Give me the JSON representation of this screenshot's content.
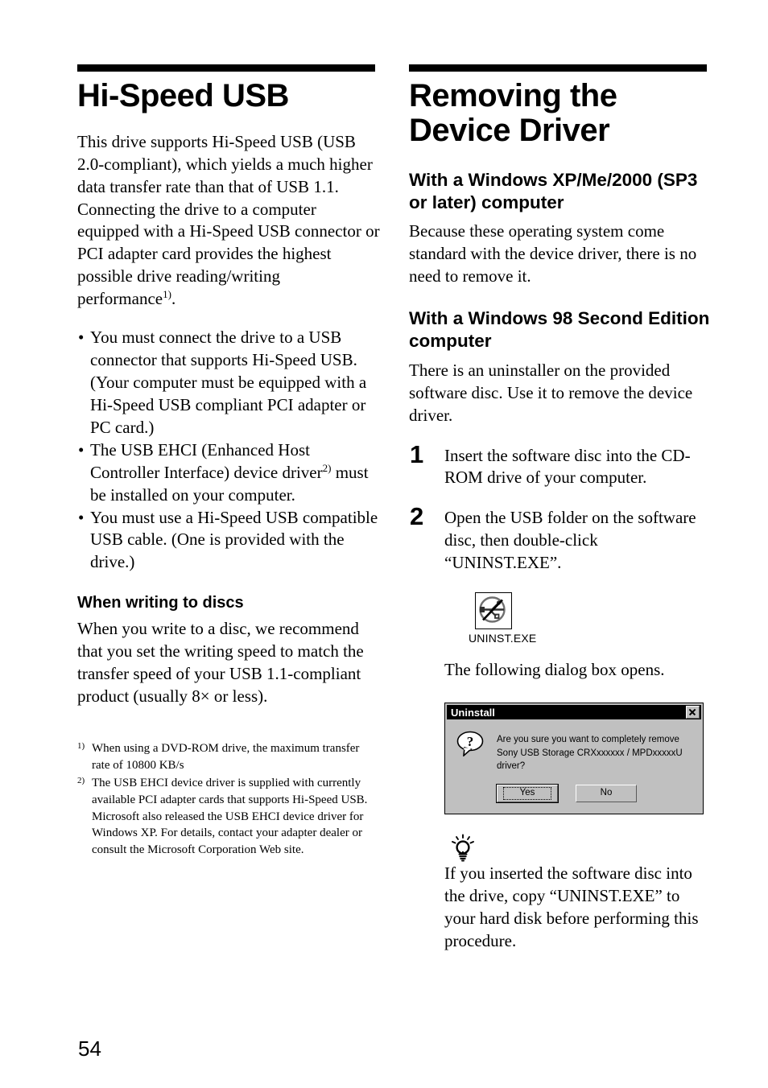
{
  "page": {
    "number": "54"
  },
  "left_column": {
    "title": "Hi-Speed USB",
    "intro_prefix": "This drive supports Hi-Speed USB (USB 2.0-compliant), which yields a much higher data transfer rate than that of USB 1.1. Connecting the drive to a computer equipped with a Hi-Speed USB connector or PCI adapter card provides the highest possible drive reading/writing performance",
    "intro_sup": "1)",
    "intro_suffix": ".",
    "bullets": [
      {
        "text_before": "You must connect the drive to a USB connector that supports Hi-Speed USB. (Your computer must be equipped with a Hi-Speed USB compliant PCI adapter or PC card.)",
        "sup": "",
        "text_after": ""
      },
      {
        "text_before": "The USB EHCI (Enhanced Host Controller Interface) device driver",
        "sup": "2)",
        "text_after": " must be installed on your computer."
      },
      {
        "text_before": "You must use a Hi-Speed USB compatible USB cable. (One is provided with the drive.)",
        "sup": "",
        "text_after": ""
      }
    ],
    "subheading_writing": "When writing to discs",
    "writing_body": "When you write to a disc, we recommend that you set the writing speed to match the transfer speed of your USB 1.1-compliant product (usually 8× or less).",
    "footnotes": [
      {
        "marker": "1)",
        "text": "When using a DVD-ROM drive, the maximum transfer rate of 10800 KB/s"
      },
      {
        "marker": "2)",
        "text": "The USB EHCI device driver is supplied with currently available PCI adapter cards that supports Hi-Speed USB. Microsoft also released the USB EHCI device driver for Windows XP. For details, contact your adapter dealer or consult the Microsoft Corporation Web site."
      }
    ]
  },
  "right_column": {
    "title": "Removing the Device Driver",
    "section_xp": {
      "heading": "With a Windows XP/Me/2000 (SP3 or later) computer",
      "body": "Because these operating system come standard with the device driver, there is no need to remove it."
    },
    "section_98": {
      "heading": "With a Windows 98 Second Edition computer",
      "body": "There is an uninstaller on the provided software disc. Use it to remove the device driver."
    },
    "steps": [
      {
        "number": "1",
        "text": "Insert the software disc into the CD-ROM drive of your computer."
      },
      {
        "number": "2",
        "text": "Open the USB folder on the software disc, then double-click “UNINST.EXE”."
      }
    ],
    "exe_icon_label": "UNINST.EXE",
    "after_icon_text": "The following dialog box opens.",
    "dialog": {
      "title": "Uninstall",
      "close_icon": "close-icon",
      "question_icon": "question-mark-icon",
      "message_line1": "Are you sure you want to completely remove",
      "message_line2": "Sony USB Storage CRXxxxxxx / MPDxxxxxU  driver?",
      "buttons": [
        {
          "label": "Yes",
          "mnemonic": "Y",
          "default": true
        },
        {
          "label": "No",
          "mnemonic": "N",
          "default": false
        }
      ]
    },
    "tip": {
      "icon": "lightbulb-icon",
      "text": "If you inserted the software disc into the drive, copy “UNINST.EXE” to your hard disk before performing this procedure."
    }
  },
  "colors": {
    "ink": "#000000",
    "paper": "#ffffff",
    "dialog_face": "#c0c0c0",
    "titlebar": "#000000"
  }
}
